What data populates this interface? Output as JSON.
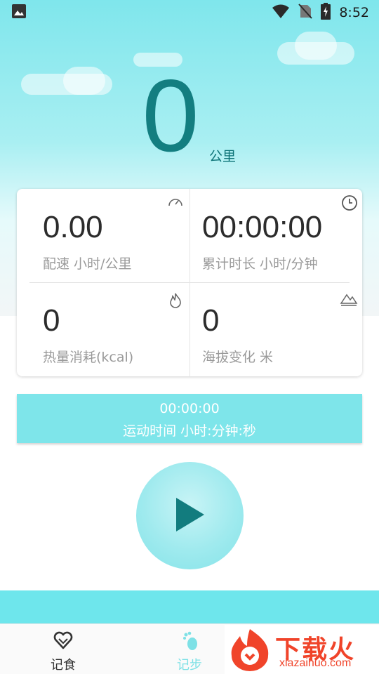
{
  "status_bar": {
    "time": "8:52"
  },
  "distance": {
    "value": "0",
    "unit": "公里"
  },
  "stats": {
    "pace": {
      "value": "0.00",
      "label": "配速  小时/公里"
    },
    "duration": {
      "value": "00:00:00",
      "label": "累计时长  小时/分钟"
    },
    "calories": {
      "value": "0",
      "label": "热量消耗(kcal)"
    },
    "altitude": {
      "value": "0",
      "label": "海拔变化 米"
    }
  },
  "sport_timer": {
    "value": "00:00:00",
    "label": "运动时间 小时:分钟:秒"
  },
  "bottom_nav": {
    "items": [
      {
        "label": "记食",
        "icon": "heart-icon",
        "color": "#333333"
      },
      {
        "label": "记步",
        "icon": "footprint-icon",
        "color": "#7ee1e6"
      }
    ]
  },
  "watermark": {
    "title": "下载火",
    "url": "xiazaihuo.com"
  },
  "colors": {
    "accent": "#137e80",
    "timer_bar": "#7ee5ea",
    "strip": "#6ee6ec",
    "watermark": "#f0442a"
  }
}
